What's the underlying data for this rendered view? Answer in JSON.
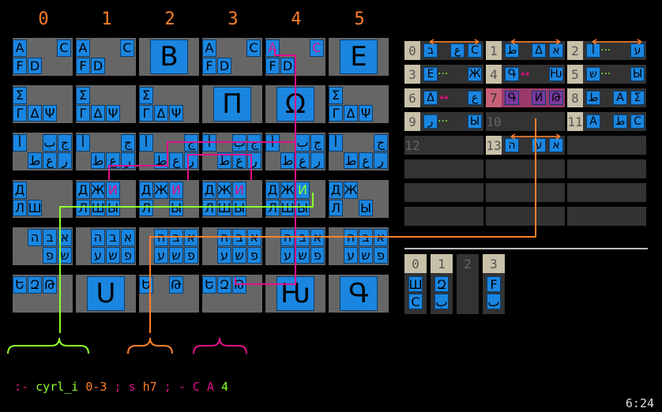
{
  "column_numbers": [
    "0",
    "1",
    "2",
    "3",
    "4",
    "5"
  ],
  "grid": [
    {
      "name": "latin",
      "cells": [
        {
          "type": "quad",
          "glyphs": [
            "A",
            "",
            "C",
            "F",
            "D",
            ""
          ]
        },
        {
          "type": "quad",
          "glyphs": [
            "A",
            "",
            "C",
            "F",
            "D",
            ""
          ]
        },
        {
          "type": "big",
          "glyph": "B"
        },
        {
          "type": "quad",
          "glyphs": [
            "A",
            "",
            "C",
            "F",
            "D",
            ""
          ]
        },
        {
          "type": "quad",
          "glyphs": [
            "A",
            "",
            "C",
            "F",
            "D",
            ""
          ],
          "highlight": "pink"
        },
        {
          "type": "big",
          "glyph": "E"
        }
      ]
    },
    {
      "name": "greek",
      "cells": [
        {
          "type": "greek",
          "glyphs": [
            "Σ",
            "Γ",
            "Δ",
            "Ψ"
          ]
        },
        {
          "type": "greek",
          "glyphs": [
            "Σ",
            "Γ",
            "Δ",
            "Ψ"
          ]
        },
        {
          "type": "greek",
          "glyphs": [
            "Σ",
            "Γ",
            "Δ",
            "Ψ"
          ]
        },
        {
          "type": "big",
          "glyph": "Π"
        },
        {
          "type": "big",
          "glyph": "Ω"
        },
        {
          "type": "greek",
          "glyphs": [
            "Σ",
            "Γ",
            "Δ",
            "Ψ"
          ]
        }
      ]
    },
    {
      "name": "arabic",
      "cells": [
        {
          "type": "arabic",
          "glyphs": [
            "أ",
            "ب",
            "ج",
            "ط",
            "ع",
            "ل",
            "ر"
          ]
        },
        {
          "type": "arabic",
          "glyphs": [
            "أ",
            "",
            "ج",
            "ط",
            "ع",
            "ل",
            "ر"
          ]
        },
        {
          "type": "arabic",
          "glyphs": [
            "أ",
            "",
            "ج",
            "ط",
            "ع",
            "ج",
            "ر"
          ]
        },
        {
          "type": "arabic",
          "glyphs": [
            "أ",
            "ب",
            "ج",
            "ط",
            "ع",
            "ج",
            "ر"
          ]
        },
        {
          "type": "arabic",
          "glyphs": [
            "أ",
            "ب",
            "ج",
            "ط",
            "ع",
            "ل",
            "ر"
          ]
        },
        {
          "type": "arabic",
          "glyphs": [
            "أ",
            "",
            "ج",
            "ط",
            "ع",
            "ل",
            "ر"
          ]
        }
      ]
    },
    {
      "name": "cyrillic",
      "cells": [
        {
          "type": "cyr",
          "top": [
            "Д",
            "",
            ""
          ],
          "bottom": [
            "Л",
            "Ш",
            "",
            ""
          ]
        },
        {
          "type": "cyr",
          "top": [
            "Д",
            "Ж",
            "И"
          ],
          "bottom": [
            "Л",
            "Ш",
            "Ы",
            ""
          ],
          "hl": "pink"
        },
        {
          "type": "cyr",
          "top": [
            "Д",
            "Ж",
            "И"
          ],
          "bottom": [
            "Л",
            "",
            "Ы",
            ""
          ],
          "hl": "pink"
        },
        {
          "type": "cyr",
          "top": [
            "Д",
            "Ж",
            "И"
          ],
          "bottom": [
            "Л",
            "Ш",
            "Ы",
            ""
          ],
          "hl": "pink"
        },
        {
          "type": "cyr",
          "top": [
            "Д",
            "Ж",
            "И"
          ],
          "bottom": [
            "Л",
            "Ш",
            "Ы",
            ""
          ],
          "hl": "green"
        },
        {
          "type": "cyr",
          "top": [
            "Д",
            "Ж",
            ""
          ],
          "bottom": [
            "Л",
            "",
            "Ы",
            ""
          ]
        }
      ]
    },
    {
      "name": "hebrew",
      "cells": [
        {
          "type": "heb",
          "top": [
            "א",
            "ב",
            "ה"
          ],
          "bottom": [
            "",
            "פ",
            "ש"
          ]
        },
        {
          "type": "heb",
          "top": [
            "א",
            "ב",
            "ה"
          ],
          "bottom": [
            "ע",
            "ש",
            "פ"
          ]
        },
        {
          "type": "heb",
          "top": [
            "א",
            "ב",
            "ה"
          ],
          "bottom": [
            "ע",
            "ש",
            "פ"
          ]
        },
        {
          "type": "heb",
          "top": [
            "א",
            "ב",
            "ה"
          ],
          "bottom": [
            "ע",
            "ש",
            "פ"
          ]
        },
        {
          "type": "heb",
          "top": [
            "א",
            "ב",
            "ה"
          ],
          "bottom": [
            "ע",
            "ש",
            "פ"
          ]
        },
        {
          "type": "heb",
          "top": [
            "א",
            "ב",
            "ה"
          ],
          "bottom": [
            "ע",
            "ש",
            "פ"
          ]
        }
      ]
    },
    {
      "name": "armenian",
      "cells": [
        {
          "type": "arm",
          "glyphs": [
            "Ե",
            "Զ",
            "Թ"
          ]
        },
        {
          "type": "big",
          "glyph": "Ս"
        },
        {
          "type": "arm2",
          "glyphs": [
            "Ե",
            "Թ"
          ]
        },
        {
          "type": "arm",
          "glyphs": [
            "Ե",
            "Զ",
            "Թ"
          ]
        },
        {
          "type": "big",
          "glyph": "Ƕ"
        },
        {
          "type": "big",
          "glyph": "Գ"
        }
      ]
    }
  ],
  "register_rows": [
    [
      {
        "n": "0",
        "g": [
          "ב",
          "ع",
          "C"
        ],
        "mid": "",
        "swap": true
      },
      {
        "n": "1",
        "g": [
          "ط",
          "Δ",
          "א"
        ],
        "mid": "",
        "swap": true
      },
      {
        "n": "2",
        "g": [
          "أ",
          "",
          "ע"
        ],
        "mid": "···",
        "swap": true
      }
    ],
    [
      {
        "n": "3",
        "g": [
          "E",
          "",
          "Ж"
        ],
        "mid": "···"
      },
      {
        "n": "4",
        "g": [
          "Գ",
          "",
          "Ƕ"
        ],
        "mid": "↔"
      },
      {
        "n": "5",
        "g": [
          "ש",
          "",
          "Ы"
        ],
        "mid": "···"
      }
    ],
    [
      {
        "n": "6",
        "g": [
          "Δ",
          "",
          "ع"
        ],
        "mid": "↔"
      },
      {
        "n": "7",
        "g": [
          "Գ",
          "И",
          "Թ"
        ],
        "mid": "",
        "selected": true
      },
      {
        "n": "8",
        "g": [
          "ط",
          "A",
          "Σ"
        ],
        "mid": ""
      }
    ],
    [
      {
        "n": "9",
        "g": [
          "ر",
          "",
          "Ы"
        ],
        "mid": "···"
      },
      {
        "n": "10",
        "g": [],
        "mid": "",
        "dim": true
      },
      {
        "n": "11",
        "g": [
          "A",
          "ط",
          "C"
        ],
        "mid": ""
      }
    ],
    [
      {
        "n": "12",
        "g": [],
        "mid": "",
        "dim": true
      },
      {
        "n": "13",
        "g": [
          "ה",
          "ע",
          "א"
        ],
        "mid": "",
        "swap": true
      },
      {
        "n": "",
        "g": []
      }
    ],
    [
      {
        "n": "",
        "g": []
      },
      {
        "n": "",
        "g": []
      },
      {
        "n": "",
        "g": []
      }
    ],
    [
      {
        "n": "",
        "g": []
      },
      {
        "n": "",
        "g": []
      },
      {
        "n": "",
        "g": []
      }
    ],
    [
      {
        "n": "",
        "g": []
      },
      {
        "n": "",
        "g": []
      },
      {
        "n": "",
        "g": []
      }
    ]
  ],
  "stack": [
    {
      "n": "0",
      "g": [
        "Ш",
        "C"
      ]
    },
    {
      "n": "1",
      "g": [
        "Զ",
        "ب"
      ]
    },
    {
      "n": "2",
      "g": []
    },
    {
      "n": "3",
      "g": [
        "F",
        "ب"
      ]
    }
  ],
  "status": {
    "prefix": ":- ",
    "p1": "cyrl_i ",
    "p2": "0-3",
    "p3": " ; ",
    "p4": "s ",
    "p5": "h7",
    "p6": " ; ",
    "p7": "- C A ",
    "p8": "4",
    "clock": "6:24"
  },
  "colors": {
    "orange": "#ff7f2a",
    "pink": "#e0108a",
    "green": "#8dff2a",
    "blue": "#1a86e0"
  }
}
